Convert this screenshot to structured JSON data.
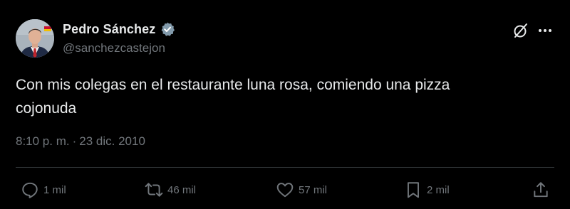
{
  "author": {
    "display_name": "Pedro Sánchez",
    "handle": "@sanchezcastejon",
    "verified": true,
    "verified_color": "#829aab"
  },
  "tweet": {
    "text_line1": "Con mis colegas en el restaurante luna rosa, comiendo una pizza",
    "text_line2": "cojonuda",
    "time": "8:10 p. m.",
    "separator": "·",
    "date": "23 dic. 2010"
  },
  "actions": {
    "replies": "1 mil",
    "reposts": "46 mil",
    "likes": "57 mil",
    "bookmarks": "2 mil"
  },
  "icons": [
    "verified-badge-icon",
    "grok-icon",
    "more-icon",
    "reply-icon",
    "repost-icon",
    "like-icon",
    "bookmark-icon",
    "share-icon"
  ],
  "colors": {
    "background": "#000000",
    "text": "#e7e9ea",
    "secondary": "#71767b",
    "divider": "#2f3336"
  }
}
